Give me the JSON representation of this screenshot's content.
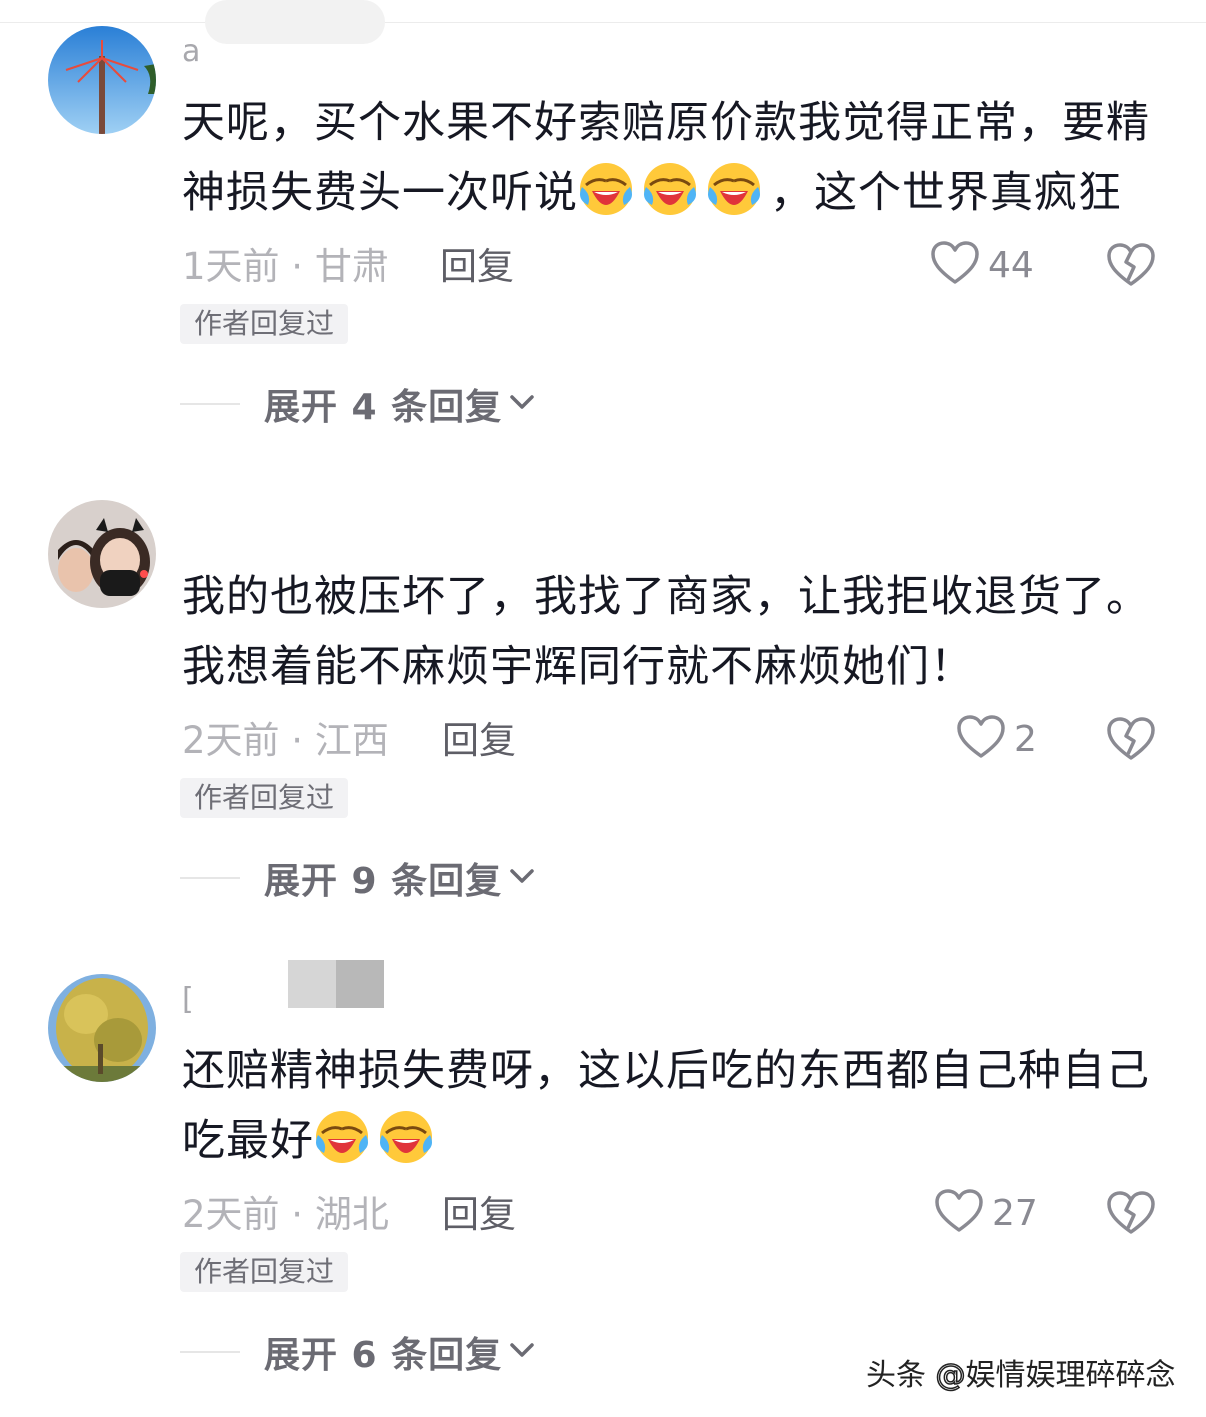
{
  "comments": [
    {
      "username": "a",
      "text_a": "天呢，买个水果不好索赔原价款我觉得正常，要精神损失费头一次听说",
      "text_b": "，这个世界真疯狂",
      "time_location": "1天前 · 甘肃",
      "reply_label": "回复",
      "likes": "44",
      "badge": "作者回复过",
      "expand": "展开 4 条回复",
      "emoji_count": 3
    },
    {
      "username": "",
      "text_a": "我的也被压坏了，我找了商家，让我拒收退货了。我想着能不麻烦宇辉同行就不麻烦她们！",
      "text_b": "",
      "time_location": "2天前 · 江西",
      "reply_label": "回复",
      "likes": "2",
      "badge": "作者回复过",
      "expand": "展开 9 条回复",
      "emoji_count": 0
    },
    {
      "username": "[",
      "text_a": "还赔精神损失费呀，这以后吃的东西都自己种自己吃最好",
      "text_b": "",
      "time_location": "2天前 · 湖北",
      "reply_label": "回复",
      "likes": "27",
      "badge": "作者回复过",
      "expand": "展开 6 条回复",
      "emoji_count": 2
    }
  ],
  "watermark": {
    "prefix": "头条",
    "at": "@",
    "handle": "娱情娱理碎碎念"
  },
  "icons": {
    "emoji": "face-with-tears-of-joy-icon",
    "like": "heart-outline-icon",
    "dislike": "broken-heart-icon",
    "expand": "chevron-down-icon"
  },
  "colors": {
    "text": "#161823",
    "meta": "#b3b3b8",
    "reply": "#5e5e66",
    "badge_bg": "#f2f2f4"
  }
}
